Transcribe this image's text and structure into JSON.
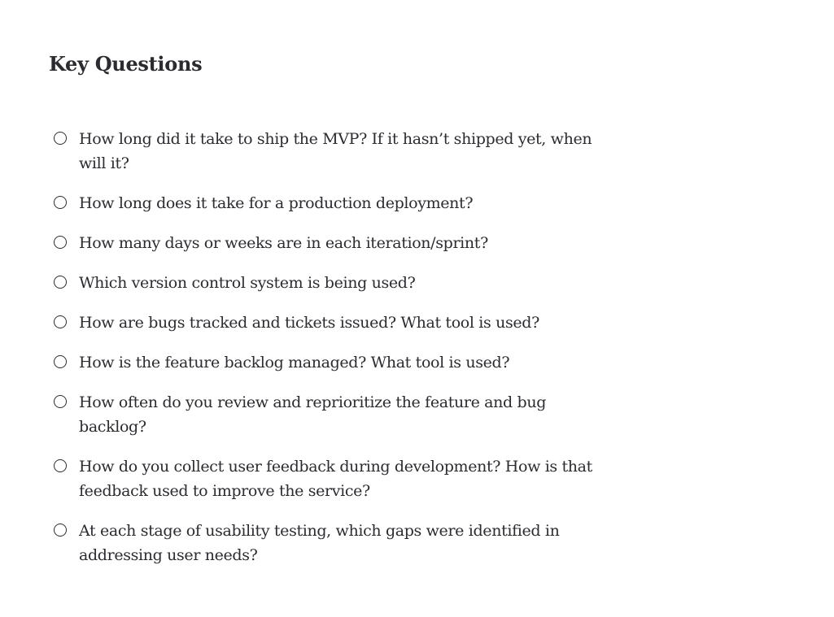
{
  "heading": "Key Questions",
  "items": [
    {
      "text": "How long did it take to ship the MVP? If it hasn’t shipped yet, when will it?"
    },
    {
      "text": "How long does it take for a production deployment?"
    },
    {
      "text": "How many days or weeks are in each iteration/sprint?"
    },
    {
      "text": "Which version control system is being used?"
    },
    {
      "text": "How are bugs tracked and tickets issued? What tool is used?"
    },
    {
      "text": "How is the feature backlog managed? What tool is used?"
    },
    {
      "text": "How often do you review and reprioritize the feature and bug backlog?"
    },
    {
      "text": "How do you collect user feedback during development? How is that feedback used to improve the service?"
    },
    {
      "text": "At each stage of usability testing, which gaps were identified in addressing user needs?"
    }
  ],
  "checkbox_icon": "circle-outline-icon"
}
